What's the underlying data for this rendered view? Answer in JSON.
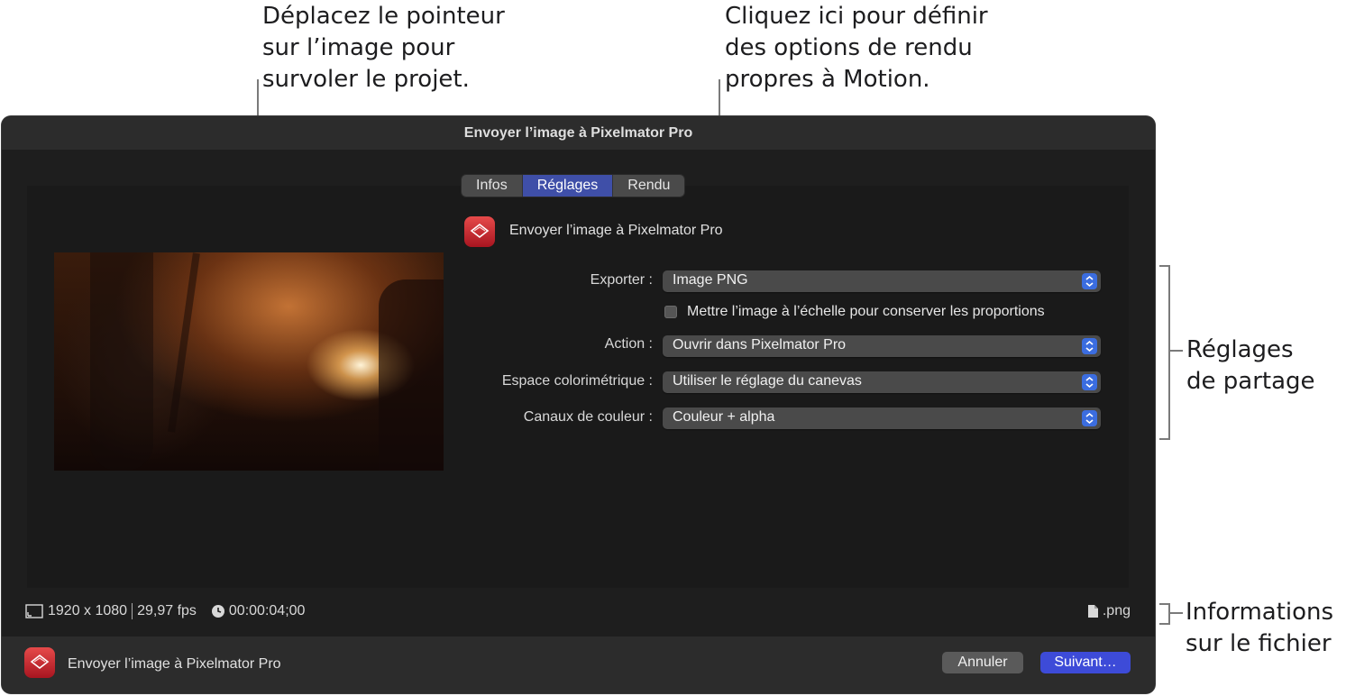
{
  "callouts": {
    "pointer": [
      "Déplacez le pointeur",
      "sur l’image pour",
      "survoler le projet."
    ],
    "render": [
      "Cliquez ici pour définir",
      "des options de rendu",
      "propres à Motion."
    ],
    "settings": [
      "Réglages",
      "de partage"
    ],
    "fileinfo": [
      "Informations",
      "sur le fichier"
    ]
  },
  "window": {
    "title": "Envoyer l’image à Pixelmator Pro"
  },
  "tabs": [
    "Infos",
    "Réglages",
    "Rendu"
  ],
  "active_tab": "Réglages",
  "destination": {
    "name": "Envoyer l’image à Pixelmator Pro",
    "icon": "pixelmator-pro-app-icon"
  },
  "form": {
    "export_label": "Exporter :",
    "export_value": "Image PNG",
    "scale_checkbox_label": "Mettre l’image à l’échelle pour conserver les proportions",
    "scale_checkbox_checked": false,
    "action_label": "Action :",
    "action_value": "Ouvrir dans Pixelmator Pro",
    "colorspace_label": "Espace colorimétrique :",
    "colorspace_value": "Utiliser le réglage du canevas",
    "channels_label": "Canaux de couleur :",
    "channels_value": "Couleur + alpha"
  },
  "info": {
    "resolution": "1920 x 1080",
    "framerate": "29,97 fps",
    "duration": "00:00:04;00",
    "extension": ".png"
  },
  "footer": {
    "title": "Envoyer l’image à Pixelmator Pro",
    "cancel_label": "Annuler",
    "next_label": "Suivant…"
  },
  "colors": {
    "accent": "#3d4bd8",
    "active_tab": "#3f4fa8",
    "window_bg": "#1e1e1e"
  }
}
